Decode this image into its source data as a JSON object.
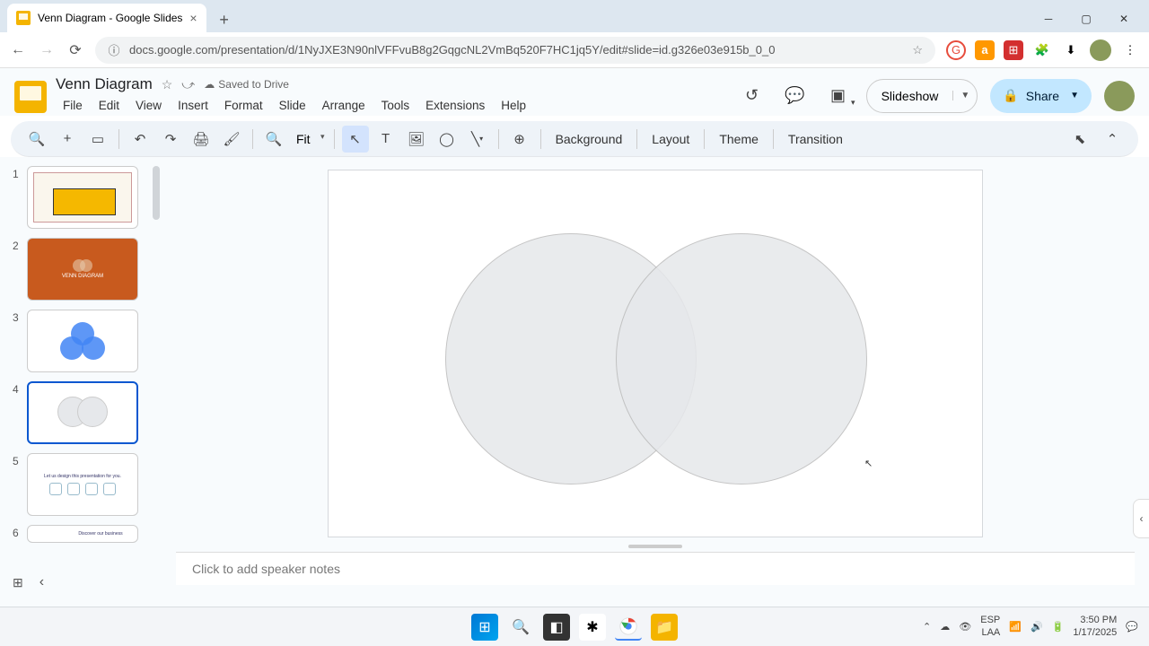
{
  "browser": {
    "tab_title": "Venn Diagram - Google Slides",
    "url": "docs.google.com/presentation/d/1NyJXE3N90nlVFFvuB8g2GqgcNL2VmBq520F7HC1jq5Y/edit#slide=id.g326e03e915b_0_0"
  },
  "doc": {
    "title": "Venn Diagram",
    "saved_status": "Saved to Drive"
  },
  "menus": [
    "File",
    "Edit",
    "View",
    "Insert",
    "Format",
    "Slide",
    "Arrange",
    "Tools",
    "Extensions",
    "Help"
  ],
  "header_buttons": {
    "slideshow": "Slideshow",
    "share": "Share"
  },
  "toolbar": {
    "zoom": "Fit",
    "background": "Background",
    "layout": "Layout",
    "theme": "Theme",
    "transition": "Transition"
  },
  "filmstrip": {
    "slides": [
      {
        "num": "1"
      },
      {
        "num": "2",
        "label": "VENN DIAGRAM"
      },
      {
        "num": "3"
      },
      {
        "num": "4"
      },
      {
        "num": "5",
        "label": "Let us design this presentation for you."
      },
      {
        "num": "6",
        "label": "Discover our business"
      }
    ],
    "selected_index": 3
  },
  "notes_placeholder": "Click to add speaker notes",
  "taskbar": {
    "lang": "ESP",
    "kb": "LAA",
    "time": "3:50 PM",
    "date": "1/17/2025"
  }
}
